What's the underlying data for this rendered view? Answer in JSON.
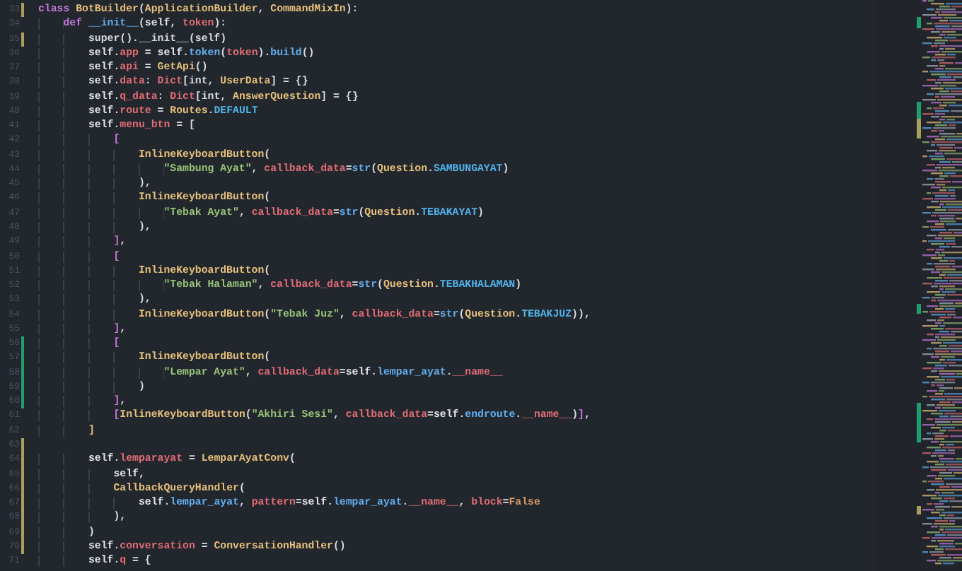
{
  "editor": {
    "lines": [
      {
        "number": "33",
        "modified": true,
        "added": false,
        "tokens": [
          {
            "kind": "kw",
            "text": "class "
          },
          {
            "kind": "cls",
            "text": "BotBuilder"
          },
          {
            "kind": "plain",
            "text": "("
          },
          {
            "kind": "cls",
            "text": "ApplicationBuilder"
          },
          {
            "kind": "plain",
            "text": ", "
          },
          {
            "kind": "cls",
            "text": "CommandMixIn"
          },
          {
            "kind": "plain",
            "text": "):"
          }
        ]
      },
      {
        "number": "34",
        "modified": false,
        "added": false,
        "tokens": [
          {
            "kind": "kw",
            "text": "    def "
          },
          {
            "kind": "fn",
            "text": "__init__"
          },
          {
            "kind": "plain",
            "text": "("
          },
          {
            "kind": "self",
            "text": "self"
          },
          {
            "kind": "plain",
            "text": ", "
          },
          {
            "kind": "param",
            "text": "token"
          },
          {
            "kind": "plain",
            "text": "):"
          }
        ]
      },
      {
        "number": "35",
        "modified": true,
        "added": false,
        "tokens": [
          {
            "kind": "plain",
            "text": "        super().__init__(self)"
          }
        ]
      },
      {
        "number": "36",
        "modified": false,
        "added": false,
        "tokens": [
          {
            "kind": "self",
            "text": "        self"
          },
          {
            "kind": "plain",
            "text": "."
          },
          {
            "kind": "attr",
            "text": "app"
          },
          {
            "kind": "plain",
            "text": " = "
          },
          {
            "kind": "self",
            "text": "self"
          },
          {
            "kind": "plain",
            "text": "."
          },
          {
            "kind": "fn",
            "text": "token"
          },
          {
            "kind": "plain",
            "text": "("
          },
          {
            "kind": "param",
            "text": "token"
          },
          {
            "kind": "plain",
            "text": ")."
          },
          {
            "kind": "fn",
            "text": "build"
          },
          {
            "kind": "plain",
            "text": "()"
          }
        ]
      },
      {
        "number": "37",
        "modified": false,
        "added": false,
        "tokens": [
          {
            "kind": "self",
            "text": "        self"
          },
          {
            "kind": "plain",
            "text": "."
          },
          {
            "kind": "attr",
            "text": "api"
          },
          {
            "kind": "plain",
            "text": " = "
          },
          {
            "kind": "cls",
            "text": "GetApi"
          },
          {
            "kind": "plain",
            "text": "()"
          }
        ]
      },
      {
        "number": "38",
        "modified": false,
        "added": false,
        "tokens": [
          {
            "kind": "self",
            "text": "        self"
          },
          {
            "kind": "plain",
            "text": "."
          },
          {
            "kind": "attr",
            "text": "data"
          },
          {
            "kind": "plain",
            "text": ": "
          },
          {
            "kind": "attr",
            "text": "Dict"
          },
          {
            "kind": "plain",
            "text": "[int, "
          },
          {
            "kind": "cls",
            "text": "UserData"
          },
          {
            "kind": "plain",
            "text": "] = {}"
          }
        ]
      },
      {
        "number": "39",
        "modified": false,
        "added": false,
        "tokens": [
          {
            "kind": "self",
            "text": "        self"
          },
          {
            "kind": "plain",
            "text": "."
          },
          {
            "kind": "attr",
            "text": "q_data"
          },
          {
            "kind": "plain",
            "text": ": "
          },
          {
            "kind": "attr",
            "text": "Dict"
          },
          {
            "kind": "plain",
            "text": "[int, "
          },
          {
            "kind": "cls",
            "text": "AnswerQuestion"
          },
          {
            "kind": "plain",
            "text": "] = {}"
          }
        ]
      },
      {
        "number": "40",
        "modified": false,
        "added": false,
        "tokens": [
          {
            "kind": "self",
            "text": "        self"
          },
          {
            "kind": "plain",
            "text": "."
          },
          {
            "kind": "attr",
            "text": "route"
          },
          {
            "kind": "plain",
            "text": " = "
          },
          {
            "kind": "cls",
            "text": "Routes"
          },
          {
            "kind": "plain",
            "text": "."
          },
          {
            "kind": "const",
            "text": "DEFAULT"
          }
        ]
      },
      {
        "number": "41",
        "modified": false,
        "added": false,
        "tokens": [
          {
            "kind": "self",
            "text": "        self"
          },
          {
            "kind": "plain",
            "text": "."
          },
          {
            "kind": "attr",
            "text": "menu_btn"
          },
          {
            "kind": "plain",
            "text": " = ["
          }
        ]
      },
      {
        "number": "42",
        "modified": false,
        "added": false,
        "tokens": [
          {
            "kind": "bracket",
            "text": "            ["
          }
        ]
      },
      {
        "number": "43",
        "modified": false,
        "added": false,
        "tokens": [
          {
            "kind": "cls",
            "text": "                InlineKeyboardButton"
          },
          {
            "kind": "plain",
            "text": "("
          }
        ]
      },
      {
        "number": "44",
        "modified": false,
        "added": false,
        "tokens": [
          {
            "kind": "str",
            "text": "                    \"Sambung Ayat\""
          },
          {
            "kind": "plain",
            "text": ", "
          },
          {
            "kind": "param",
            "text": "callback_data"
          },
          {
            "kind": "plain",
            "text": "="
          },
          {
            "kind": "fn",
            "text": "str"
          },
          {
            "kind": "plain",
            "text": "("
          },
          {
            "kind": "cls",
            "text": "Question"
          },
          {
            "kind": "plain",
            "text": "."
          },
          {
            "kind": "const",
            "text": "SAMBUNGAYAT"
          },
          {
            "kind": "plain",
            "text": ")"
          }
        ]
      },
      {
        "number": "45",
        "modified": false,
        "added": false,
        "tokens": [
          {
            "kind": "plain",
            "text": "                ),"
          }
        ]
      },
      {
        "number": "46",
        "modified": false,
        "added": false,
        "tokens": [
          {
            "kind": "cls",
            "text": "                InlineKeyboardButton"
          },
          {
            "kind": "plain",
            "text": "("
          }
        ]
      },
      {
        "number": "47",
        "modified": false,
        "added": false,
        "tokens": [
          {
            "kind": "str",
            "text": "                    \"Tebak Ayat\""
          },
          {
            "kind": "plain",
            "text": ", "
          },
          {
            "kind": "param",
            "text": "callback_data"
          },
          {
            "kind": "plain",
            "text": "="
          },
          {
            "kind": "fn",
            "text": "str"
          },
          {
            "kind": "plain",
            "text": "("
          },
          {
            "kind": "cls",
            "text": "Question"
          },
          {
            "kind": "plain",
            "text": "."
          },
          {
            "kind": "const",
            "text": "TEBAKAYAT"
          },
          {
            "kind": "plain",
            "text": ")"
          }
        ]
      },
      {
        "number": "48",
        "modified": false,
        "added": false,
        "tokens": [
          {
            "kind": "plain",
            "text": "                ),"
          }
        ]
      },
      {
        "number": "49",
        "modified": false,
        "added": false,
        "tokens": [
          {
            "kind": "bracket",
            "text": "            ]"
          },
          {
            "kind": "plain",
            "text": ","
          }
        ]
      },
      {
        "number": "50",
        "modified": false,
        "added": false,
        "tokens": [
          {
            "kind": "bracket",
            "text": "            ["
          }
        ]
      },
      {
        "number": "51",
        "modified": false,
        "added": false,
        "tokens": [
          {
            "kind": "cls",
            "text": "                InlineKeyboardButton"
          },
          {
            "kind": "plain",
            "text": "("
          }
        ]
      },
      {
        "number": "52",
        "modified": false,
        "added": false,
        "tokens": [
          {
            "kind": "str",
            "text": "                    \"Tebak Halaman\""
          },
          {
            "kind": "plain",
            "text": ", "
          },
          {
            "kind": "param",
            "text": "callback_data"
          },
          {
            "kind": "plain",
            "text": "="
          },
          {
            "kind": "fn",
            "text": "str"
          },
          {
            "kind": "plain",
            "text": "("
          },
          {
            "kind": "cls",
            "text": "Question"
          },
          {
            "kind": "plain",
            "text": "."
          },
          {
            "kind": "const",
            "text": "TEBAKHALAMAN"
          },
          {
            "kind": "plain",
            "text": ")"
          }
        ]
      },
      {
        "number": "53",
        "modified": false,
        "added": false,
        "tokens": [
          {
            "kind": "plain",
            "text": "                ),"
          }
        ]
      },
      {
        "number": "54",
        "modified": false,
        "added": false,
        "tokens": [
          {
            "kind": "cls",
            "text": "                InlineKeyboardButton"
          },
          {
            "kind": "plain",
            "text": "("
          },
          {
            "kind": "str",
            "text": "\"Tebak Juz\""
          },
          {
            "kind": "plain",
            "text": ", "
          },
          {
            "kind": "param",
            "text": "callback_data"
          },
          {
            "kind": "plain",
            "text": "="
          },
          {
            "kind": "fn",
            "text": "str"
          },
          {
            "kind": "plain",
            "text": "("
          },
          {
            "kind": "cls",
            "text": "Question"
          },
          {
            "kind": "plain",
            "text": "."
          },
          {
            "kind": "const",
            "text": "TEBAKJUZ"
          },
          {
            "kind": "plain",
            "text": ")),"
          }
        ]
      },
      {
        "number": "55",
        "modified": false,
        "added": false,
        "tokens": [
          {
            "kind": "bracket",
            "text": "            ]"
          },
          {
            "kind": "plain",
            "text": ","
          }
        ]
      },
      {
        "number": "56",
        "modified": false,
        "added": true,
        "tokens": [
          {
            "kind": "bracket",
            "text": "            ["
          }
        ]
      },
      {
        "number": "57",
        "modified": false,
        "added": true,
        "tokens": [
          {
            "kind": "cls",
            "text": "                InlineKeyboardButton"
          },
          {
            "kind": "plain",
            "text": "("
          }
        ]
      },
      {
        "number": "58",
        "modified": false,
        "added": true,
        "tokens": [
          {
            "kind": "str",
            "text": "                    \"Lempar Ayat\""
          },
          {
            "kind": "plain",
            "text": ", "
          },
          {
            "kind": "param",
            "text": "callback_data"
          },
          {
            "kind": "plain",
            "text": "="
          },
          {
            "kind": "self",
            "text": "self"
          },
          {
            "kind": "plain",
            "text": "."
          },
          {
            "kind": "fn",
            "text": "lempar_ayat"
          },
          {
            "kind": "plain",
            "text": "."
          },
          {
            "kind": "attr",
            "text": "__name__"
          }
        ]
      },
      {
        "number": "59",
        "modified": false,
        "added": true,
        "tokens": [
          {
            "kind": "plain",
            "text": "                )"
          }
        ]
      },
      {
        "number": "60",
        "modified": false,
        "added": true,
        "tokens": [
          {
            "kind": "bracket",
            "text": "            ]"
          },
          {
            "kind": "plain",
            "text": ","
          }
        ]
      },
      {
        "number": "61",
        "modified": false,
        "added": false,
        "tokens": [
          {
            "kind": "bracket",
            "text": "            ["
          },
          {
            "kind": "cls",
            "text": "InlineKeyboardButton"
          },
          {
            "kind": "plain",
            "text": "("
          },
          {
            "kind": "str",
            "text": "\"Akhiri Sesi\""
          },
          {
            "kind": "plain",
            "text": ", "
          },
          {
            "kind": "param",
            "text": "callback_data"
          },
          {
            "kind": "plain",
            "text": "="
          },
          {
            "kind": "self",
            "text": "self"
          },
          {
            "kind": "plain",
            "text": "."
          },
          {
            "kind": "fn",
            "text": "endroute"
          },
          {
            "kind": "plain",
            "text": "."
          },
          {
            "kind": "attr",
            "text": "__name__"
          },
          {
            "kind": "plain",
            "text": ")"
          },
          {
            "kind": "bracket",
            "text": "]"
          },
          {
            "kind": "plain",
            "text": ","
          }
        ]
      },
      {
        "number": "62",
        "modified": false,
        "added": false,
        "tokens": [
          {
            "kind": "cls",
            "text": "        ]"
          }
        ]
      },
      {
        "number": "63",
        "modified": true,
        "added": false
      },
      {
        "number": "64",
        "modified": true,
        "added": false,
        "tokens": [
          {
            "kind": "self",
            "text": "        self"
          },
          {
            "kind": "plain",
            "text": "."
          },
          {
            "kind": "attr",
            "text": "lemparayat"
          },
          {
            "kind": "plain",
            "text": " = "
          },
          {
            "kind": "cls",
            "text": "LemparAyatConv"
          },
          {
            "kind": "plain",
            "text": "("
          }
        ]
      },
      {
        "number": "65",
        "modified": true,
        "added": false,
        "tokens": [
          {
            "kind": "self",
            "text": "            self"
          },
          {
            "kind": "plain",
            "text": ","
          }
        ]
      },
      {
        "number": "66",
        "modified": true,
        "added": false,
        "tokens": [
          {
            "kind": "cls",
            "text": "            CallbackQueryHandler"
          },
          {
            "kind": "plain",
            "text": "("
          }
        ]
      },
      {
        "number": "67",
        "modified": true,
        "added": false,
        "tokens": [
          {
            "kind": "self",
            "text": "                self"
          },
          {
            "kind": "plain",
            "text": "."
          },
          {
            "kind": "fn",
            "text": "lempar_ayat"
          },
          {
            "kind": "plain",
            "text": ", "
          },
          {
            "kind": "param",
            "text": "pattern"
          },
          {
            "kind": "plain",
            "text": "="
          },
          {
            "kind": "self",
            "text": "self"
          },
          {
            "kind": "plain",
            "text": "."
          },
          {
            "kind": "fn",
            "text": "lempar_ayat"
          },
          {
            "kind": "plain",
            "text": "."
          },
          {
            "kind": "attr",
            "text": "__name__"
          },
          {
            "kind": "plain",
            "text": ", "
          },
          {
            "kind": "param",
            "text": "block"
          },
          {
            "kind": "plain",
            "text": "="
          },
          {
            "kind": "num",
            "text": "False"
          }
        ]
      },
      {
        "number": "68",
        "modified": true,
        "added": false,
        "tokens": [
          {
            "kind": "plain",
            "text": "            ),"
          }
        ]
      },
      {
        "number": "69",
        "modified": true,
        "added": false,
        "tokens": [
          {
            "kind": "plain",
            "text": "        )"
          }
        ]
      },
      {
        "number": "70",
        "modified": true,
        "added": false,
        "tokens": [
          {
            "kind": "self",
            "text": "        self"
          },
          {
            "kind": "plain",
            "text": "."
          },
          {
            "kind": "attr",
            "text": "conversation"
          },
          {
            "kind": "plain",
            "text": " = "
          },
          {
            "kind": "cls",
            "text": "ConversationHandler"
          },
          {
            "kind": "plain",
            "text": "()"
          }
        ]
      },
      {
        "number": "71",
        "modified": false,
        "added": false,
        "tokens": [
          {
            "kind": "self",
            "text": "        self"
          },
          {
            "kind": "plain",
            "text": "."
          },
          {
            "kind": "attr",
            "text": "q"
          },
          {
            "kind": "plain",
            "text": " = {"
          }
        ]
      }
    ]
  }
}
